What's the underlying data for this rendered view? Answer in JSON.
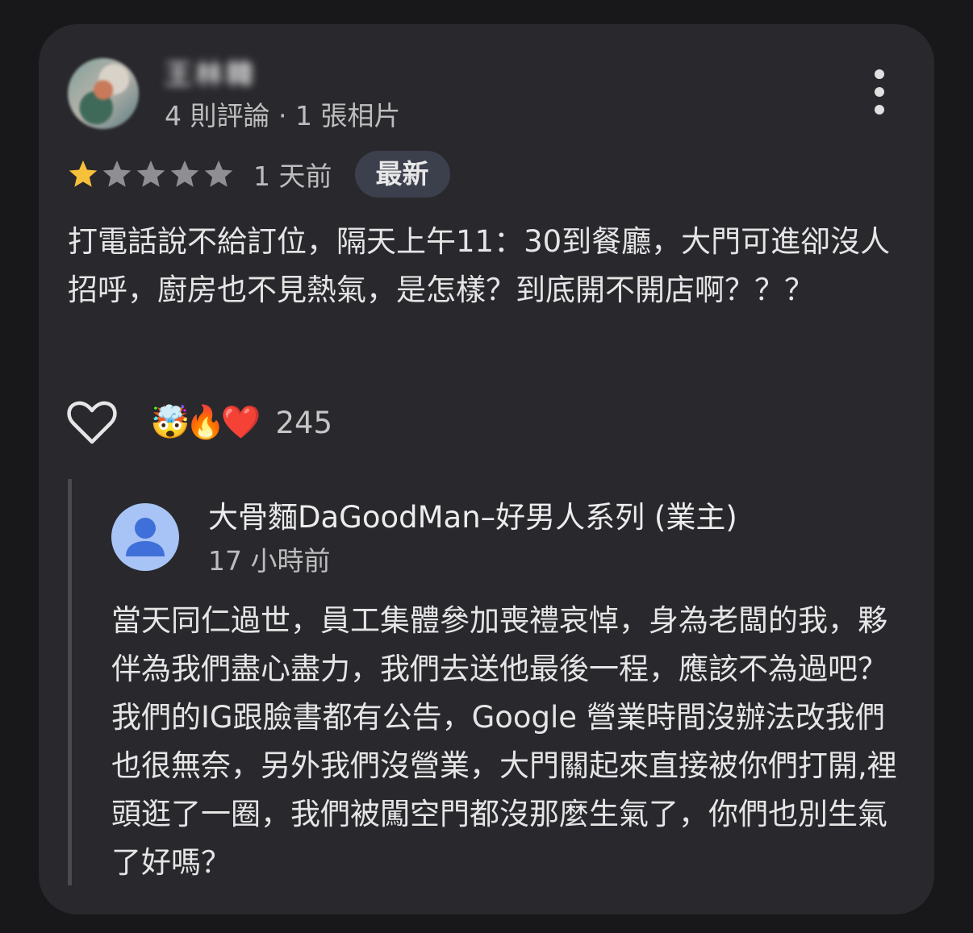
{
  "review": {
    "reviewer_name": "王林韓",
    "reviewer_meta": "4 則評論 · 1 張相片",
    "rating": 1,
    "max_rating": 5,
    "time_ago": "1 天前",
    "badge": "最新",
    "text": "打電話說不給訂位，隔天上午11：30到餐廳，大門可進卻沒人招呼，廚房也不見熱氣，是怎樣？到底開不開店啊？？？",
    "reactions": {
      "emojis": [
        "🤯",
        "🔥",
        "❤️"
      ],
      "count": "245"
    }
  },
  "reply": {
    "owner_name": "大骨麵DaGoodMan–好男人系列 (業主)",
    "time_ago": "17 小時前",
    "text": "當天同仁過世，員工集體參加喪禮哀悼，身為老闆的我，夥伴為我們盡心盡力，我們去送他最後一程，應該不為過吧？我們的IG跟臉書都有公告，Google 營業時間沒辦法改我們也很無奈，另外我們沒營業，大門關起來直接被你們打開,裡頭逛了一圈，我們被闖空門都沒那麼生氣了，你們也別生氣了好嗎？"
  },
  "colors": {
    "background": "#18181b",
    "card": "#28282d",
    "star_filled": "#f6c03b",
    "star_empty": "#8e8e93",
    "badge_bg": "#3c3f4c",
    "owner_avatar": "#a8c3f5",
    "owner_avatar_figure": "#3f6fd8"
  },
  "icons": {
    "more": "more-vert-icon",
    "like": "heart-outline-icon",
    "owner_avatar": "person-icon"
  }
}
